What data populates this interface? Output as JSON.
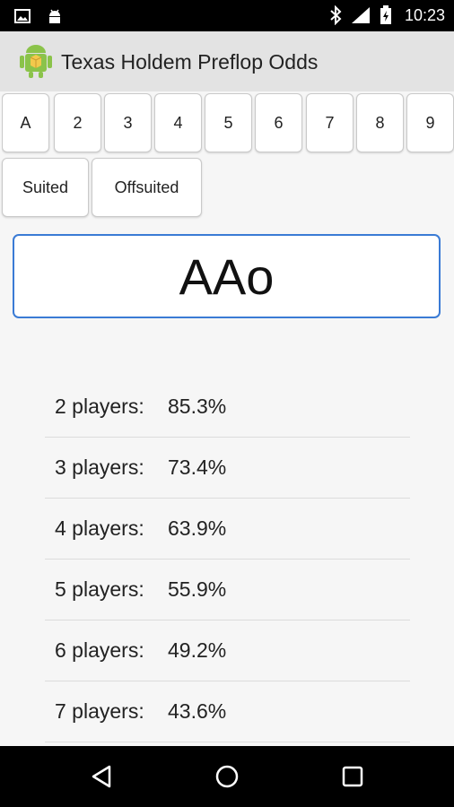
{
  "status_bar": {
    "time": "10:23",
    "icons": [
      "image-icon",
      "android-debug-icon",
      "bluetooth-icon",
      "wifi-icon",
      "battery-charging-icon"
    ]
  },
  "app": {
    "title": "Texas Holdem Preflop Odds",
    "icon": "android-app-icon"
  },
  "ranks": [
    "A",
    "2",
    "3",
    "4",
    "5",
    "6",
    "7",
    "8",
    "9"
  ],
  "suit_options": [
    "Suited",
    "Offsuited"
  ],
  "hand": "AAo",
  "odds": [
    {
      "players": "2 players:",
      "percent": "85.3%"
    },
    {
      "players": "3 players:",
      "percent": "73.4%"
    },
    {
      "players": "4 players:",
      "percent": "63.9%"
    },
    {
      "players": "5 players:",
      "percent": "55.9%"
    },
    {
      "players": "6 players:",
      "percent": "49.2%"
    },
    {
      "players": "7 players:",
      "percent": "43.6%"
    }
  ],
  "nav": [
    "back-icon",
    "home-icon",
    "recents-icon"
  ],
  "colors": {
    "accent": "#3a7bd5",
    "action_bar": "#e3e3e3",
    "status_bar": "#000000"
  }
}
